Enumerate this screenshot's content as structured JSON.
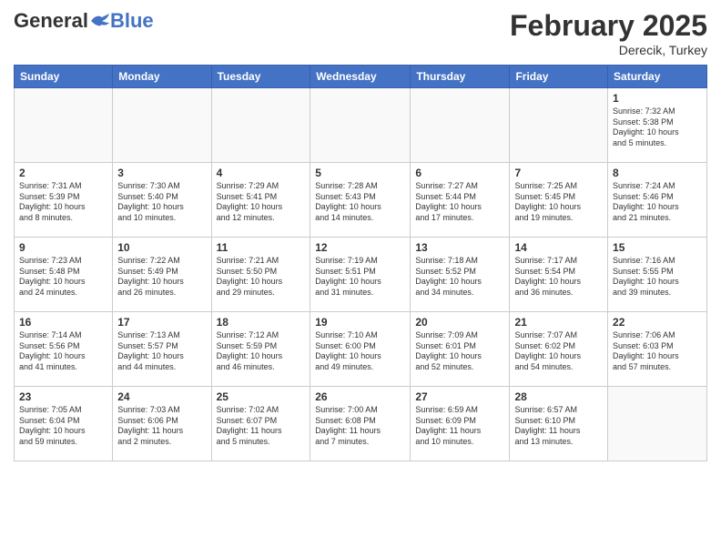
{
  "header": {
    "logo_general": "General",
    "logo_blue": "Blue",
    "month_year": "February 2025",
    "location": "Derecik, Turkey"
  },
  "days_of_week": [
    "Sunday",
    "Monday",
    "Tuesday",
    "Wednesday",
    "Thursday",
    "Friday",
    "Saturday"
  ],
  "weeks": [
    [
      {
        "day": "",
        "info": ""
      },
      {
        "day": "",
        "info": ""
      },
      {
        "day": "",
        "info": ""
      },
      {
        "day": "",
        "info": ""
      },
      {
        "day": "",
        "info": ""
      },
      {
        "day": "",
        "info": ""
      },
      {
        "day": "1",
        "info": "Sunrise: 7:32 AM\nSunset: 5:38 PM\nDaylight: 10 hours\nand 5 minutes."
      }
    ],
    [
      {
        "day": "2",
        "info": "Sunrise: 7:31 AM\nSunset: 5:39 PM\nDaylight: 10 hours\nand 8 minutes."
      },
      {
        "day": "3",
        "info": "Sunrise: 7:30 AM\nSunset: 5:40 PM\nDaylight: 10 hours\nand 10 minutes."
      },
      {
        "day": "4",
        "info": "Sunrise: 7:29 AM\nSunset: 5:41 PM\nDaylight: 10 hours\nand 12 minutes."
      },
      {
        "day": "5",
        "info": "Sunrise: 7:28 AM\nSunset: 5:43 PM\nDaylight: 10 hours\nand 14 minutes."
      },
      {
        "day": "6",
        "info": "Sunrise: 7:27 AM\nSunset: 5:44 PM\nDaylight: 10 hours\nand 17 minutes."
      },
      {
        "day": "7",
        "info": "Sunrise: 7:25 AM\nSunset: 5:45 PM\nDaylight: 10 hours\nand 19 minutes."
      },
      {
        "day": "8",
        "info": "Sunrise: 7:24 AM\nSunset: 5:46 PM\nDaylight: 10 hours\nand 21 minutes."
      }
    ],
    [
      {
        "day": "9",
        "info": "Sunrise: 7:23 AM\nSunset: 5:48 PM\nDaylight: 10 hours\nand 24 minutes."
      },
      {
        "day": "10",
        "info": "Sunrise: 7:22 AM\nSunset: 5:49 PM\nDaylight: 10 hours\nand 26 minutes."
      },
      {
        "day": "11",
        "info": "Sunrise: 7:21 AM\nSunset: 5:50 PM\nDaylight: 10 hours\nand 29 minutes."
      },
      {
        "day": "12",
        "info": "Sunrise: 7:19 AM\nSunset: 5:51 PM\nDaylight: 10 hours\nand 31 minutes."
      },
      {
        "day": "13",
        "info": "Sunrise: 7:18 AM\nSunset: 5:52 PM\nDaylight: 10 hours\nand 34 minutes."
      },
      {
        "day": "14",
        "info": "Sunrise: 7:17 AM\nSunset: 5:54 PM\nDaylight: 10 hours\nand 36 minutes."
      },
      {
        "day": "15",
        "info": "Sunrise: 7:16 AM\nSunset: 5:55 PM\nDaylight: 10 hours\nand 39 minutes."
      }
    ],
    [
      {
        "day": "16",
        "info": "Sunrise: 7:14 AM\nSunset: 5:56 PM\nDaylight: 10 hours\nand 41 minutes."
      },
      {
        "day": "17",
        "info": "Sunrise: 7:13 AM\nSunset: 5:57 PM\nDaylight: 10 hours\nand 44 minutes."
      },
      {
        "day": "18",
        "info": "Sunrise: 7:12 AM\nSunset: 5:59 PM\nDaylight: 10 hours\nand 46 minutes."
      },
      {
        "day": "19",
        "info": "Sunrise: 7:10 AM\nSunset: 6:00 PM\nDaylight: 10 hours\nand 49 minutes."
      },
      {
        "day": "20",
        "info": "Sunrise: 7:09 AM\nSunset: 6:01 PM\nDaylight: 10 hours\nand 52 minutes."
      },
      {
        "day": "21",
        "info": "Sunrise: 7:07 AM\nSunset: 6:02 PM\nDaylight: 10 hours\nand 54 minutes."
      },
      {
        "day": "22",
        "info": "Sunrise: 7:06 AM\nSunset: 6:03 PM\nDaylight: 10 hours\nand 57 minutes."
      }
    ],
    [
      {
        "day": "23",
        "info": "Sunrise: 7:05 AM\nSunset: 6:04 PM\nDaylight: 10 hours\nand 59 minutes."
      },
      {
        "day": "24",
        "info": "Sunrise: 7:03 AM\nSunset: 6:06 PM\nDaylight: 11 hours\nand 2 minutes."
      },
      {
        "day": "25",
        "info": "Sunrise: 7:02 AM\nSunset: 6:07 PM\nDaylight: 11 hours\nand 5 minutes."
      },
      {
        "day": "26",
        "info": "Sunrise: 7:00 AM\nSunset: 6:08 PM\nDaylight: 11 hours\nand 7 minutes."
      },
      {
        "day": "27",
        "info": "Sunrise: 6:59 AM\nSunset: 6:09 PM\nDaylight: 11 hours\nand 10 minutes."
      },
      {
        "day": "28",
        "info": "Sunrise: 6:57 AM\nSunset: 6:10 PM\nDaylight: 11 hours\nand 13 minutes."
      },
      {
        "day": "",
        "info": ""
      }
    ]
  ]
}
